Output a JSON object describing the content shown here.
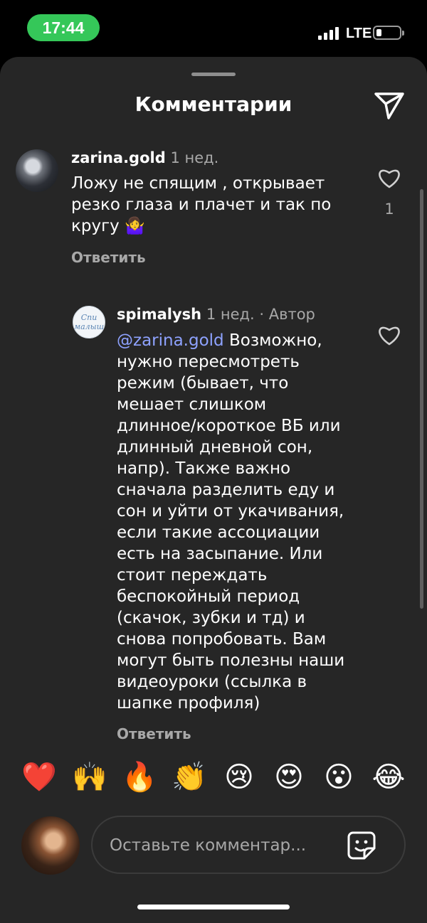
{
  "status_bar": {
    "time": "17:44",
    "network": "LTE",
    "battery_level": 0.2
  },
  "sheet": {
    "title": "Комментарии",
    "share_icon": "paper-plane-icon"
  },
  "comments": [
    {
      "username": "zarina.gold",
      "meta": "1 нед.",
      "text_lines": [
        "Ложу не спящим , открывает",
        "резко глаза и плачет и так по",
        "кругу 🤷‍♀️"
      ],
      "likes": "1",
      "reply_label": "Ответить"
    }
  ],
  "reply": {
    "username": "spimalysh",
    "meta": "1 нед. · Автор",
    "avatar_text": "Спи малыш",
    "mention": "@zarina.gold",
    "first_line_rest": "Возможно,",
    "text_lines": [
      "нужно пересмотреть",
      "режим (бывает, что",
      "мешает слишком",
      "длинное/короткое ВБ или",
      "длинный дневной сон,",
      "напр). Также важно",
      "сначала разделить еду и",
      "сон и уйти от укачивания,",
      "если такие ассоциации",
      "есть на засыпание. Или",
      "стоит переждать",
      "беспокойный период",
      "(скачок, зубки и тд) и",
      "снова попробовать. Вам",
      "могут быть полезны наши",
      "видеоуроки (ссылка в",
      "шапке профиля)"
    ],
    "reply_label": "Ответить"
  },
  "emoji_reactions": [
    "❤️",
    "🙌",
    "🔥",
    "👏",
    "😢",
    "😍",
    "😮",
    "😂"
  ],
  "composer": {
    "placeholder": "Оставьте комментар...",
    "sticker_icon": "sticker-icon"
  }
}
